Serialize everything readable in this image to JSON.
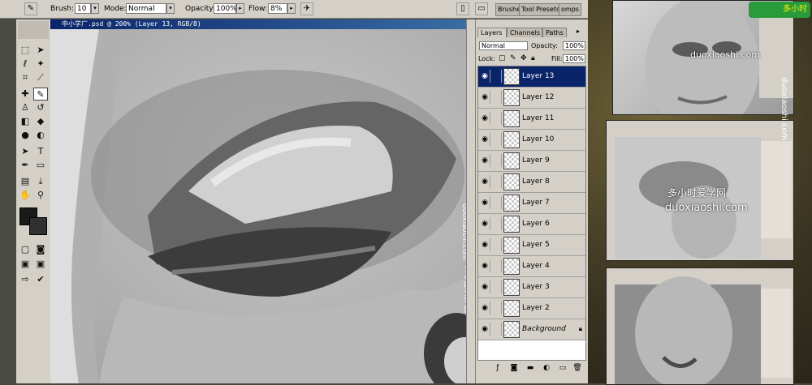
{
  "options_bar": {
    "brush_label": "Brush:",
    "brush_size": "10",
    "mode_label": "Mode:",
    "mode_value": "Normal",
    "opacity_label": "Opacity:",
    "opacity_value": "100%",
    "flow_label": "Flow:",
    "flow_value": "8%",
    "palette_well_tabs": [
      "Brushes",
      "Tool Presets",
      "omps"
    ]
  },
  "document": {
    "title": "中小学厂.psd @ 200% (Layer 13, RGB/8)"
  },
  "layers_panel": {
    "tabs": [
      "Layers",
      "Channels",
      "Paths"
    ],
    "active_tab": "Layers",
    "blend_mode": "Normal",
    "opacity_label": "Opacity:",
    "opacity_value": "100%",
    "lock_label": "Lock:",
    "fill_label": "Fill:",
    "fill_value": "100%",
    "layers": [
      {
        "name": "Layer 13",
        "selected": true
      },
      {
        "name": "Layer 12",
        "selected": false
      },
      {
        "name": "Layer 11",
        "selected": false
      },
      {
        "name": "Layer 10",
        "selected": false
      },
      {
        "name": "Layer 9",
        "selected": false
      },
      {
        "name": "Layer 8",
        "selected": false
      },
      {
        "name": "Layer 7",
        "selected": false
      },
      {
        "name": "Layer 6",
        "selected": false
      },
      {
        "name": "Layer 5",
        "selected": false
      },
      {
        "name": "Layer 4",
        "selected": false
      },
      {
        "name": "Layer 3",
        "selected": false
      },
      {
        "name": "Layer 2",
        "selected": false
      },
      {
        "name": "Background",
        "selected": false,
        "locked": true
      }
    ]
  },
  "watermarks": {
    "site_domain": "duoxiaoshi.com",
    "site_name_cn": "多小时爱学网",
    "canvas_vertical_cn": "多小时爱学网",
    "canvas_vertical_domain": "duoxiaoshi.com",
    "right_vertical_domain": "duoxiaoshi.com",
    "logo_text": "多小时"
  },
  "colors": {
    "titlebar_start": "#0a246a",
    "titlebar_end": "#3a6ea5",
    "panel_bg": "#d4d0c8",
    "selection": "#0a246a"
  }
}
